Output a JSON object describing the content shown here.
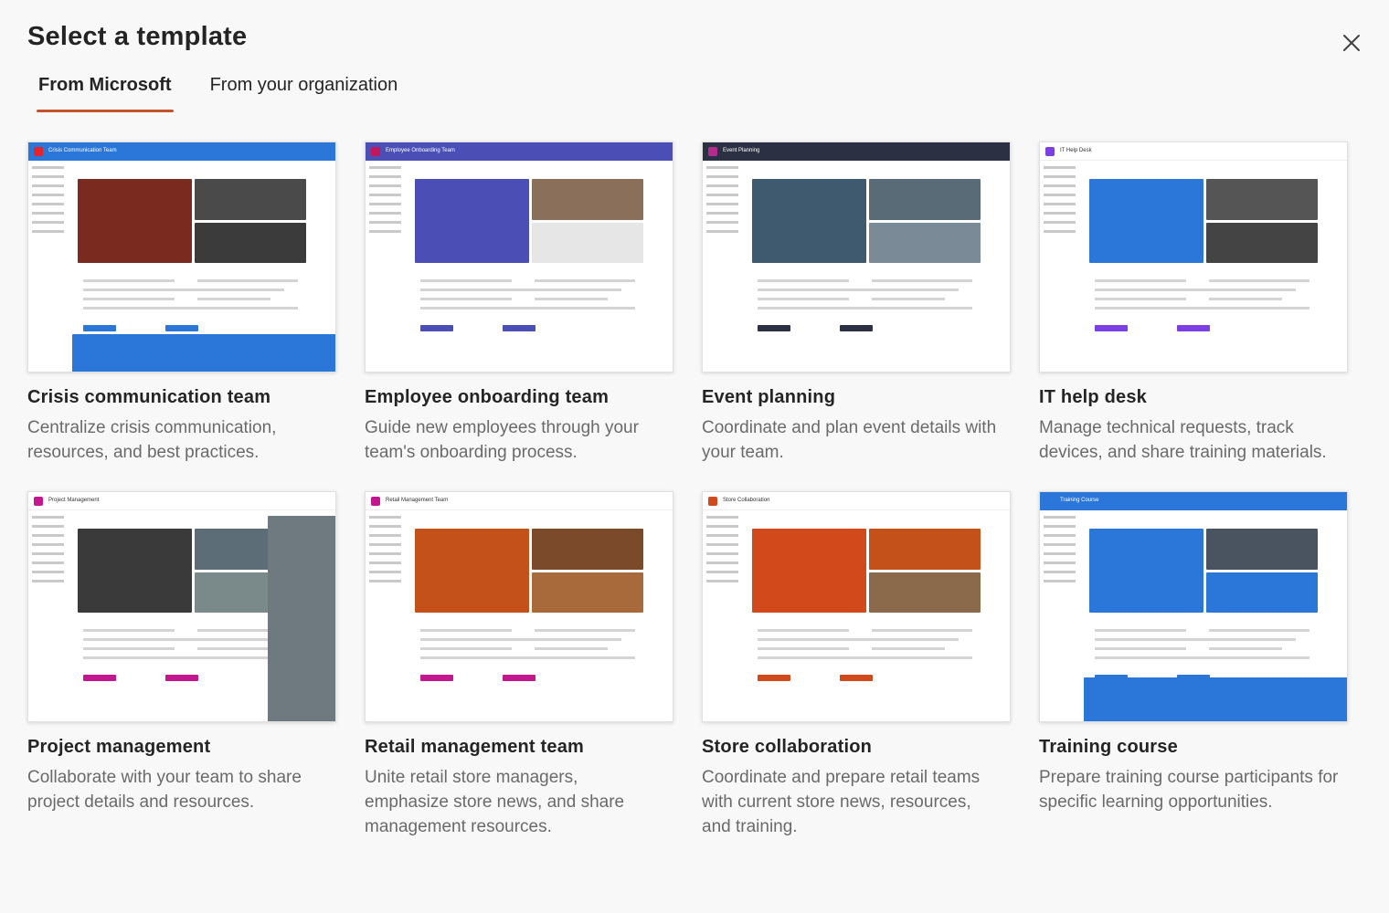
{
  "dialog": {
    "title": "Select a template",
    "close_icon": "close-icon"
  },
  "tabs": [
    {
      "label": "From Microsoft",
      "active": true
    },
    {
      "label": "From your organization",
      "active": false
    }
  ],
  "accent_color": "#c4522d",
  "templates": [
    {
      "title": "Crisis communication team",
      "description": "Centralize crisis communication, resources, and best practices.",
      "thumb_site_name": "Crisis Communication Team",
      "theme": "#2b77d9",
      "logo": "#e3242b"
    },
    {
      "title": "Employee onboarding team",
      "description": "Guide new employees through your team's onboarding process.",
      "thumb_site_name": "Employee Onboarding Team",
      "theme": "#4b4fb5",
      "logo": "#c2185b"
    },
    {
      "title": "Event planning",
      "description": "Coordinate and plan event details with your team.",
      "thumb_site_name": "Event Planning",
      "theme": "#2b3142",
      "logo": "#b52a8f"
    },
    {
      "title": "IT help desk",
      "description": "Manage technical requests, track devices, and share training materials.",
      "thumb_site_name": "IT Help Desk",
      "theme": "#ffffff",
      "logo": "#7b3fe4"
    },
    {
      "title": "Project management",
      "description": "Collaborate with your team to share project details and resources.",
      "thumb_site_name": "Project Management",
      "theme": "#ffffff",
      "logo": "#c4178f"
    },
    {
      "title": "Retail management team",
      "description": "Unite retail store managers, emphasize store news, and share management resources.",
      "thumb_site_name": "Retail Management Team",
      "theme": "#ffffff",
      "logo": "#c4178f"
    },
    {
      "title": "Store collaboration",
      "description": "Coordinate and prepare retail teams with current store news, resources, and training.",
      "thumb_site_name": "Store Collaboration",
      "theme": "#ffffff",
      "logo": "#d2491b"
    },
    {
      "title": "Training course",
      "description": "Prepare training course participants for specific learning opportunities.",
      "thumb_site_name": "Training Course",
      "theme": "#2b77d9",
      "logo": "#2b77d9"
    }
  ]
}
